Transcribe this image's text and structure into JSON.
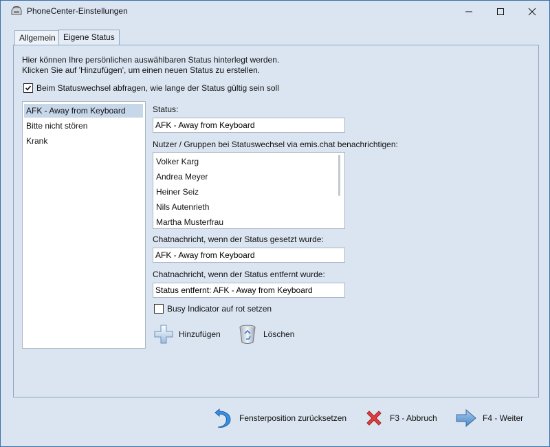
{
  "window": {
    "title": "PhoneCenter-Einstellungen",
    "controls": {
      "minimize": "–",
      "maximize": "☐",
      "close": "✕"
    }
  },
  "tabs": [
    {
      "label": "Allgemein",
      "active": false
    },
    {
      "label": "Eigene Status",
      "active": true
    }
  ],
  "panel": {
    "description_line1": "Hier können Ihre persönlichen auswählbaren Status hinterlegt werden.",
    "description_line2": "Klicken Sie auf 'Hinzufügen', um einen neuen Status zu erstellen.",
    "ask_validity": {
      "label": "Beim Statuswechsel abfragen, wie lange der Status gültig sein soll",
      "checked": true
    },
    "status_list": [
      {
        "label": "AFK - Away from Keyboard",
        "selected": true
      },
      {
        "label": "Bitte nicht stören",
        "selected": false
      },
      {
        "label": "Krank",
        "selected": false
      }
    ],
    "status_label": "Status:",
    "status_value": "AFK - Away from Keyboard",
    "notify_label": "Nutzer / Gruppen bei Statuswechsel via emis.chat benachrichtigen:",
    "notify_users": [
      "Volker Karg",
      "Andrea Meyer",
      "Heiner Seiz",
      "Nils Autenrieth",
      "Martha Musterfrau"
    ],
    "set_msg_label": "Chatnachricht, wenn der Status gesetzt wurde:",
    "set_msg_value": "AFK - Away from Keyboard",
    "removed_msg_label": "Chatnachricht, wenn der Status entfernt wurde:",
    "removed_msg_value": "Status entfernt: AFK - Away from Keyboard",
    "busy": {
      "label": "Busy Indicator auf rot setzen",
      "checked": false
    },
    "add_label": "Hinzufügen",
    "delete_label": "Löschen"
  },
  "footer": {
    "reset_label": "Fensterposition zurücksetzen",
    "cancel_label": "F3 - Abbruch",
    "next_label": "F4 - Weiter"
  },
  "colors": {
    "accent": "#3a6ea5",
    "background": "#dbe5f1",
    "selection": "#c7d7ea"
  }
}
